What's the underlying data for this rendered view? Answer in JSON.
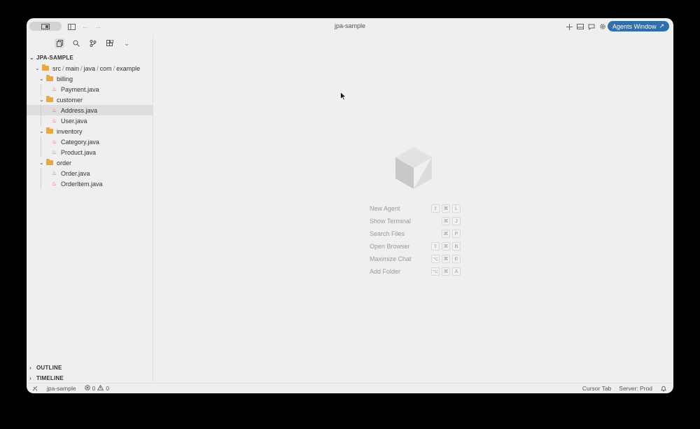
{
  "window": {
    "title": "jpa-sample",
    "agents_button_label": "Agents Window",
    "agents_button_arrow": "↗"
  },
  "sidebar": {
    "project_name": "JPA-SAMPLE",
    "path_segments": [
      "src",
      "main",
      "java",
      "com",
      "example"
    ],
    "path_separator": "/",
    "tree": [
      {
        "type": "folder",
        "name": "billing",
        "level": 1
      },
      {
        "type": "file",
        "name": "Payment.java",
        "level": 2
      },
      {
        "type": "folder",
        "name": "customer",
        "level": 1
      },
      {
        "type": "file",
        "name": "Address.java",
        "level": 2,
        "selected": true
      },
      {
        "type": "file",
        "name": "User.java",
        "level": 2
      },
      {
        "type": "folder",
        "name": "inventory",
        "level": 1
      },
      {
        "type": "file",
        "name": "Category.java",
        "level": 2
      },
      {
        "type": "file",
        "name": "Product.java",
        "level": 2
      },
      {
        "type": "folder",
        "name": "order",
        "level": 1
      },
      {
        "type": "file",
        "name": "Order.java",
        "level": 2
      },
      {
        "type": "file",
        "name": "OrderItem.java",
        "level": 2
      }
    ],
    "outline_label": "OUTLINE",
    "timeline_label": "TIMELINE"
  },
  "shortcuts": [
    {
      "label": "New Agent",
      "keys": [
        "⇧",
        "⌘",
        "L"
      ]
    },
    {
      "label": "Show Terminal",
      "keys": [
        "⌘",
        "J"
      ]
    },
    {
      "label": "Search Files",
      "keys": [
        "⌘",
        "P"
      ]
    },
    {
      "label": "Open Browser",
      "keys": [
        "⇧",
        "⌘",
        "B"
      ]
    },
    {
      "label": "Maximize Chat",
      "keys": [
        "⌥",
        "⌘",
        "E"
      ]
    },
    {
      "label": "Add Folder",
      "keys": [
        "⌥",
        "⌘",
        "A"
      ]
    }
  ],
  "statusbar": {
    "workspace": "jpa-sample",
    "errors": "0",
    "warnings": "0",
    "cursor_tab": "Cursor Tab",
    "server": "Server: Prod"
  },
  "colors": {
    "accent": "#2f6fab",
    "folder": "#e6a843",
    "java_icon": "#c8533a"
  }
}
